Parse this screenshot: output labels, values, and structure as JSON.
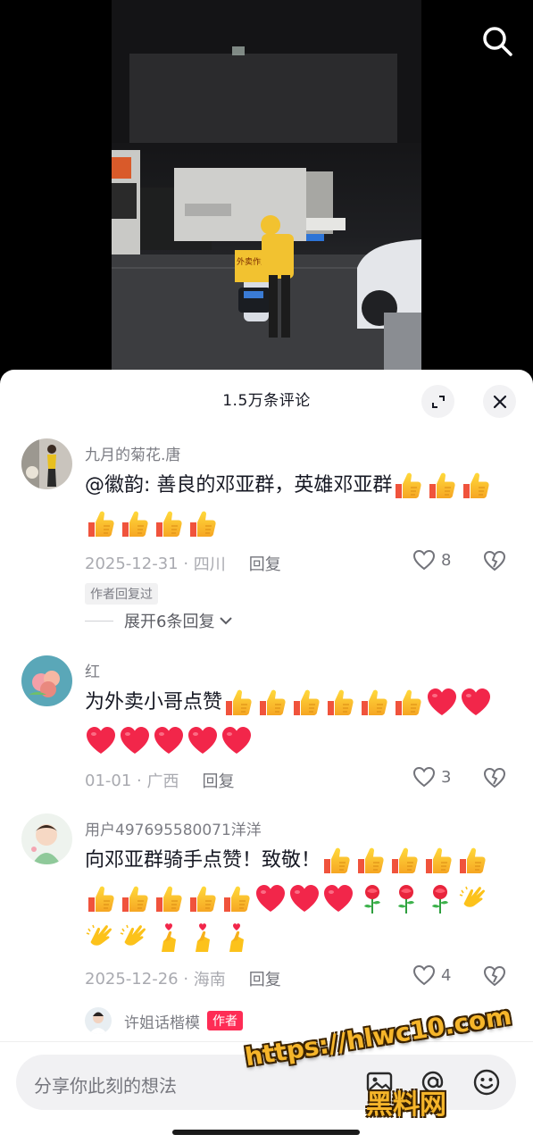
{
  "header": {
    "comment_count_title": "1.5万条评论"
  },
  "video": {
    "scooter_sign_text": "外卖作业"
  },
  "comments": [
    {
      "username": "九月的菊花.唐",
      "text_line1": "@徽韵: 善良的邓亚群，英雄邓亚群",
      "date": "2025-12-31",
      "location": "四川",
      "reply_label": "回复",
      "likes": "8",
      "author_replied_badge": "作者回复过",
      "expand_label": "展开6条回复"
    },
    {
      "username": "红",
      "text_line1": "为外卖小哥点赞",
      "date": "01-01",
      "location": "广西",
      "reply_label": "回复",
      "likes": "3"
    },
    {
      "username": "用户497695580071洋洋",
      "text_line1": "向邓亚群骑手点赞！致敬！",
      "date": "2025-12-26",
      "location": "海南",
      "reply_label": "回复",
      "likes": "4"
    }
  ],
  "sub_reply": {
    "username": "许姐话楷模",
    "badge": "作者"
  },
  "input": {
    "placeholder": "分享你此刻的想法"
  },
  "watermark": {
    "url": "https://hlwc10.com",
    "name": "黑料网"
  },
  "icons": {
    "search": "search-icon",
    "expand": "expand-icon",
    "close": "close-icon",
    "like": "heart-outline-icon",
    "dislike": "broken-heart-icon",
    "chevron": "chevron-down-icon",
    "image": "image-icon",
    "at": "at-icon",
    "emoji": "emoji-icon"
  },
  "emojis": {
    "thumbs_up": "thumbs-up-emoji",
    "red_heart": "red-heart-emoji",
    "rose": "rose-emoji",
    "clapping": "clapping-hands-emoji",
    "finger_heart": "finger-heart-emoji"
  },
  "colors": {
    "author_badge": "#fe2c55",
    "text_primary": "#161823",
    "text_secondary": "#a9aab0"
  }
}
